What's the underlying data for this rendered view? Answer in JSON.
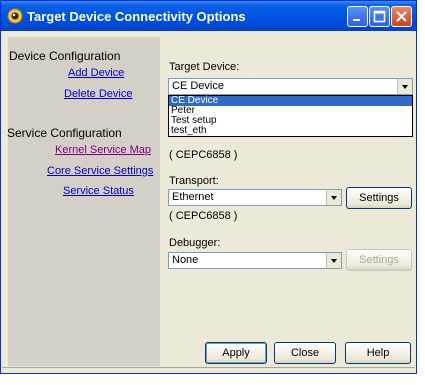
{
  "window": {
    "title": "Target Device Connectivity Options",
    "title_color": "#0054e3"
  },
  "sidebar": {
    "device_section": {
      "heading": "Device Configuration",
      "links": [
        {
          "label": "Add Device"
        },
        {
          "label": "Delete Device"
        }
      ]
    },
    "service_section": {
      "heading": "Service Configuration",
      "links": [
        {
          "label": "Kernel Service Map",
          "visited": true
        },
        {
          "label": "Core Service Settings"
        },
        {
          "label": "Service Status"
        }
      ]
    }
  },
  "target_device": {
    "label": "Target Device:",
    "value": "CE Device",
    "options": [
      "CE Device",
      "Peter",
      "Test setup",
      "test_eth"
    ],
    "selected_index": 0
  },
  "download": {
    "note": "( CEPC6858 )"
  },
  "transport": {
    "label": "Transport:",
    "value": "Ethernet",
    "settings_label": "Settings",
    "note": "( CEPC6858 )"
  },
  "debugger": {
    "label": "Debugger:",
    "value": "None",
    "settings_label": "Settings",
    "settings_enabled": false
  },
  "buttons": {
    "apply": "Apply",
    "close": "Close",
    "help": "Help"
  },
  "colors": {
    "link": "#0000cc",
    "link_visited": "#800080",
    "selection": "#316ac5",
    "panel": "#d4d0c8",
    "dialog": "#ece9d8"
  }
}
